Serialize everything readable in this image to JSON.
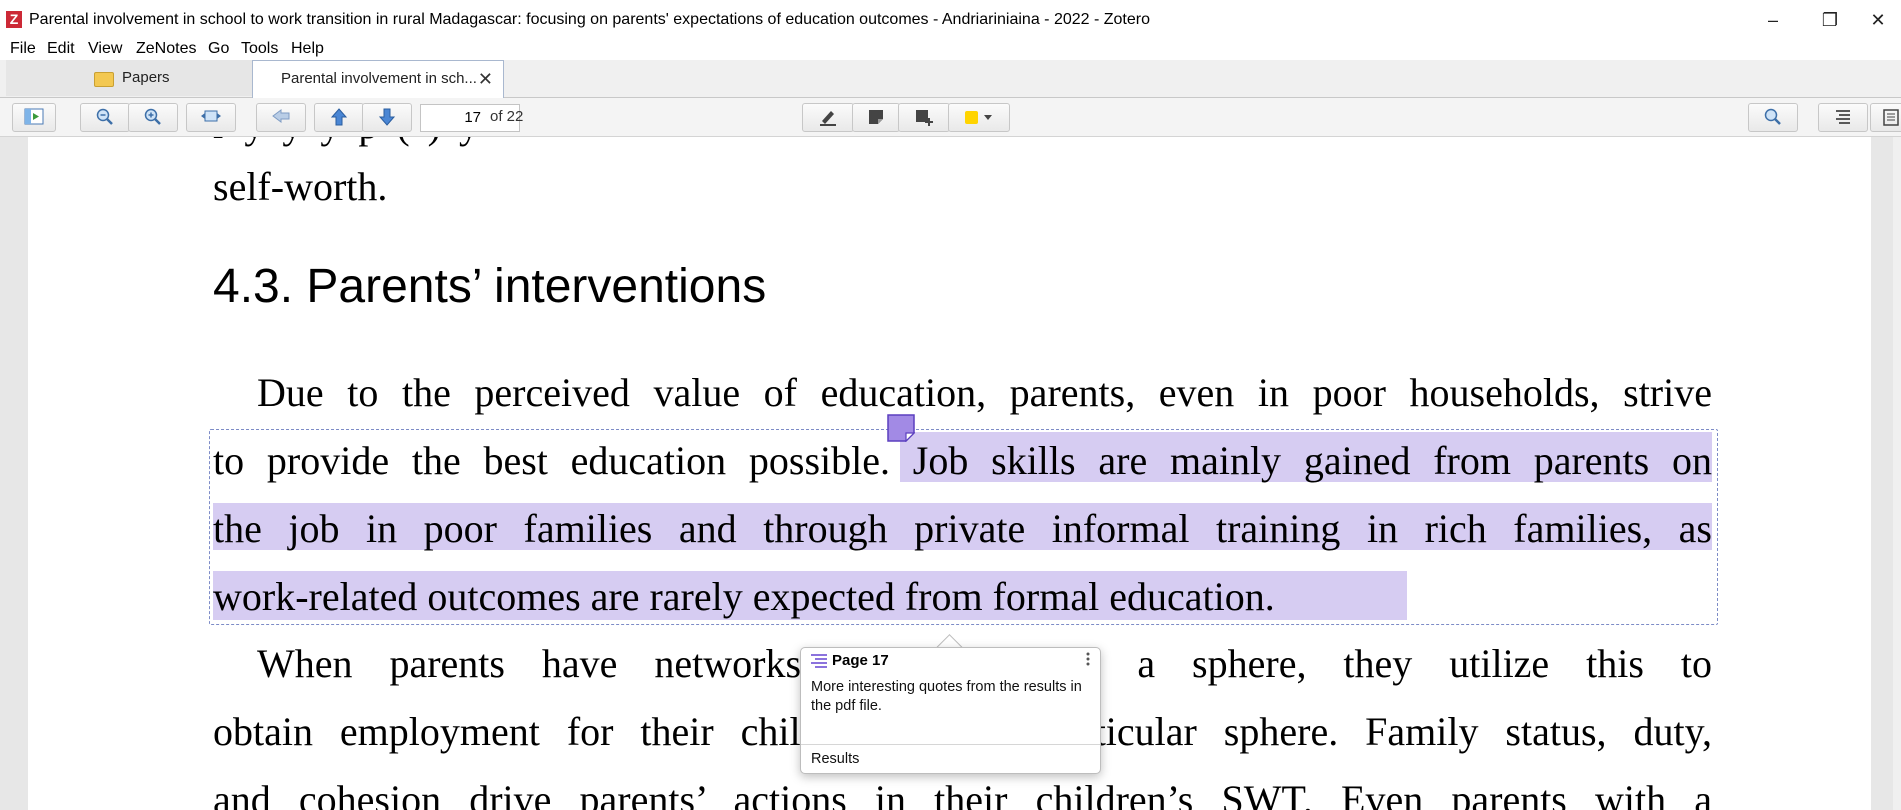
{
  "window": {
    "title": "Parental involvement in school to work transition in rural Madagascar: focusing on parents' expectations of education outcomes - Andriariniaina - 2022 - Zotero",
    "logo": "Z"
  },
  "menu": [
    "File",
    "Edit",
    "View",
    "ZeNotes",
    "Go",
    "Tools",
    "Help"
  ],
  "tabs": {
    "library_label": "Papers",
    "reader_label": "Parental involvement in sch..."
  },
  "toolbar": {
    "page_number": "17",
    "page_of": "of 22",
    "highlight_color": "#ffd400"
  },
  "document": {
    "line_top": "self-worth.",
    "heading": "4.3. Parents’ interventions",
    "para1": [
      "Due to the perceived value of education, parents, even in poor households, strive",
      "to provide the best education possible. Job skills are mainly gained from parents on",
      "the job in poor families and through private informal training in rich families, as",
      "work-related outcomes are rarely expected from formal education."
    ],
    "para2": [
      "When parents have networks, particularly in a sphere, they utilize this to",
      "obtain employment for their children in that particular sphere. Family status, duty,",
      "and cohesion drive parents’ actions in their children’s SWT. Even parents with a"
    ],
    "highlight_color": "#d6ccf2"
  },
  "annotation_popup": {
    "title": "Page 17",
    "comment": "More interesting quotes from the results in the pdf file.",
    "tag": "Results"
  }
}
